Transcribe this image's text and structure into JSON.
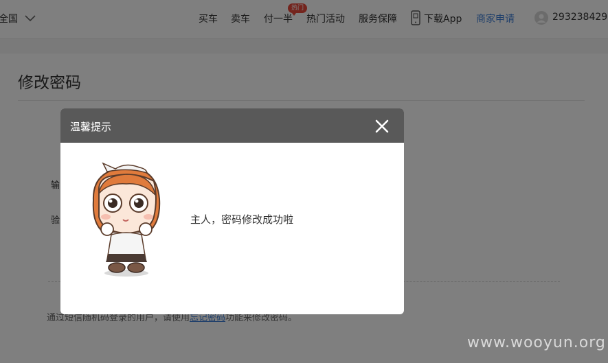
{
  "header": {
    "city": "全国",
    "nav": [
      "买车",
      "卖车",
      "付一半",
      "热门活动",
      "服务保障"
    ],
    "hot_badge": "热门",
    "download_app": "下载App",
    "merchant": "商家申请",
    "user_id": "293238429",
    "colors": {
      "link_blue": "#3f7fd6",
      "badge_red": "#e8483b"
    }
  },
  "page": {
    "title": "修改密码",
    "field_label_1": "输",
    "field_label_2": "验",
    "footnote_pre": "通过短信随机码登录的用户，请使用",
    "footnote_link": "忘记密码",
    "footnote_post": "功能来修改密码。"
  },
  "dialog": {
    "title": "温馨提示",
    "close_icon": "close-icon",
    "message": "主人，密码修改成功啦",
    "header_color": "#595959"
  },
  "watermark": "www.wooyun.org"
}
